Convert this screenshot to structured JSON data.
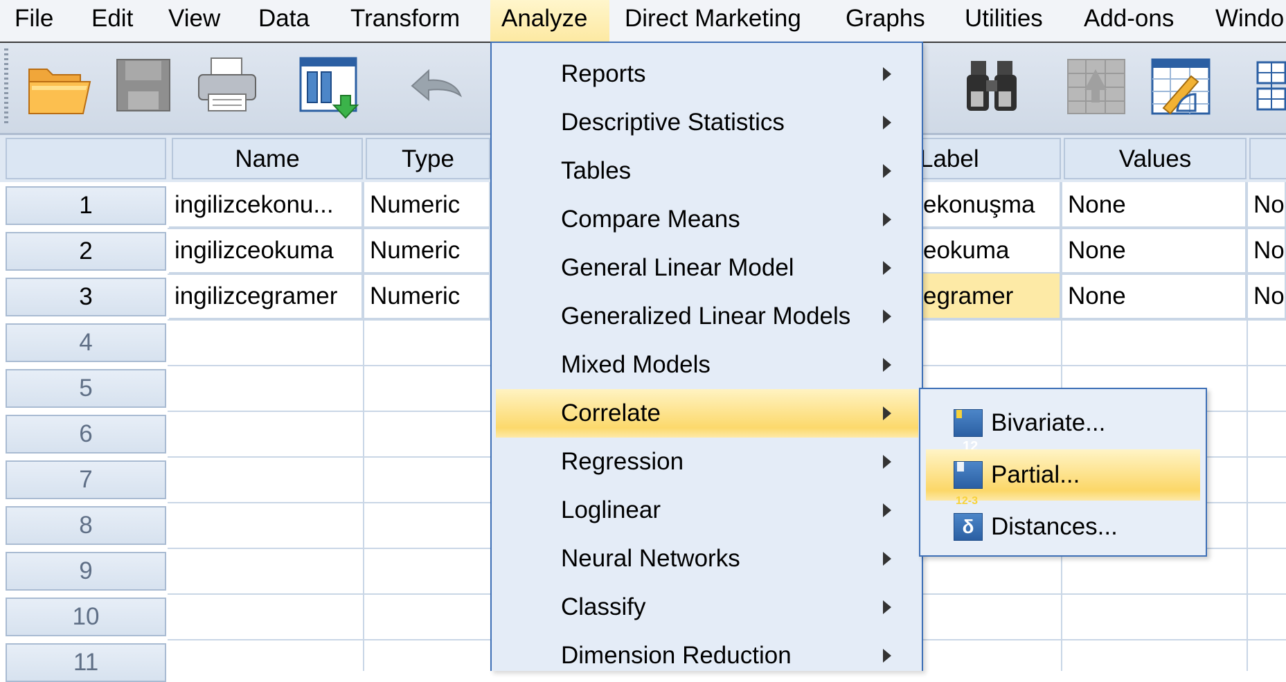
{
  "menubar": {
    "items": [
      "File",
      "Edit",
      "View",
      "Data",
      "Transform",
      "Analyze",
      "Direct Marketing",
      "Graphs",
      "Utilities",
      "Add-ons",
      "Windo"
    ],
    "active": "Analyze"
  },
  "toolbar": {
    "buttons": [
      "open-folder-icon",
      "save-icon",
      "print-icon",
      "recall-dialog-icon",
      "undo-icon",
      "find-icon",
      "go-to-case-icon",
      "variables-icon",
      "value-labels-icon"
    ]
  },
  "grid": {
    "headers": {
      "name": "Name",
      "type": "Type",
      "label": "Label",
      "values": "Values"
    },
    "rows": [
      {
        "num": "1",
        "name": "ingilizcekonu...",
        "type": "Numeric",
        "label": "ekonuşma",
        "values": "None",
        "missing": "No"
      },
      {
        "num": "2",
        "name": "ingilizceokuma",
        "type": "Numeric",
        "label": "eokuma",
        "values": "None",
        "missing": "No"
      },
      {
        "num": "3",
        "name": "ingilizcegramer",
        "type": "Numeric",
        "label": "egramer",
        "values": "None",
        "missing": "No"
      }
    ],
    "empty_rows": [
      "4",
      "5",
      "6",
      "7",
      "8",
      "9",
      "10",
      "11"
    ]
  },
  "analyze_menu": {
    "items": [
      {
        "label": "Reports"
      },
      {
        "label": "Descriptive Statistics"
      },
      {
        "label": "Tables"
      },
      {
        "label": "Compare Means"
      },
      {
        "label": "General Linear Model"
      },
      {
        "label": "Generalized Linear Models"
      },
      {
        "label": "Mixed Models"
      },
      {
        "label": "Correlate"
      },
      {
        "label": "Regression"
      },
      {
        "label": "Loglinear"
      },
      {
        "label": "Neural Networks"
      },
      {
        "label": "Classify"
      },
      {
        "label": "Dimension Reduction"
      }
    ],
    "active": "Correlate"
  },
  "correlate_menu": {
    "items": [
      {
        "label": "Bivariate...",
        "icon": "bivariate-icon",
        "icon_text": "r12"
      },
      {
        "label": "Partial...",
        "icon": "partial-icon",
        "icon_text": "r12-3"
      },
      {
        "label": "Distances...",
        "icon": "distances-icon",
        "icon_text": "δ"
      }
    ],
    "active": "Partial..."
  },
  "colors": {
    "menu_highlight": "#fcd96c",
    "menu_border": "#3d6fb6",
    "menu_bg": "#e4ecf7",
    "selected_cell": "#fdeaa6"
  }
}
